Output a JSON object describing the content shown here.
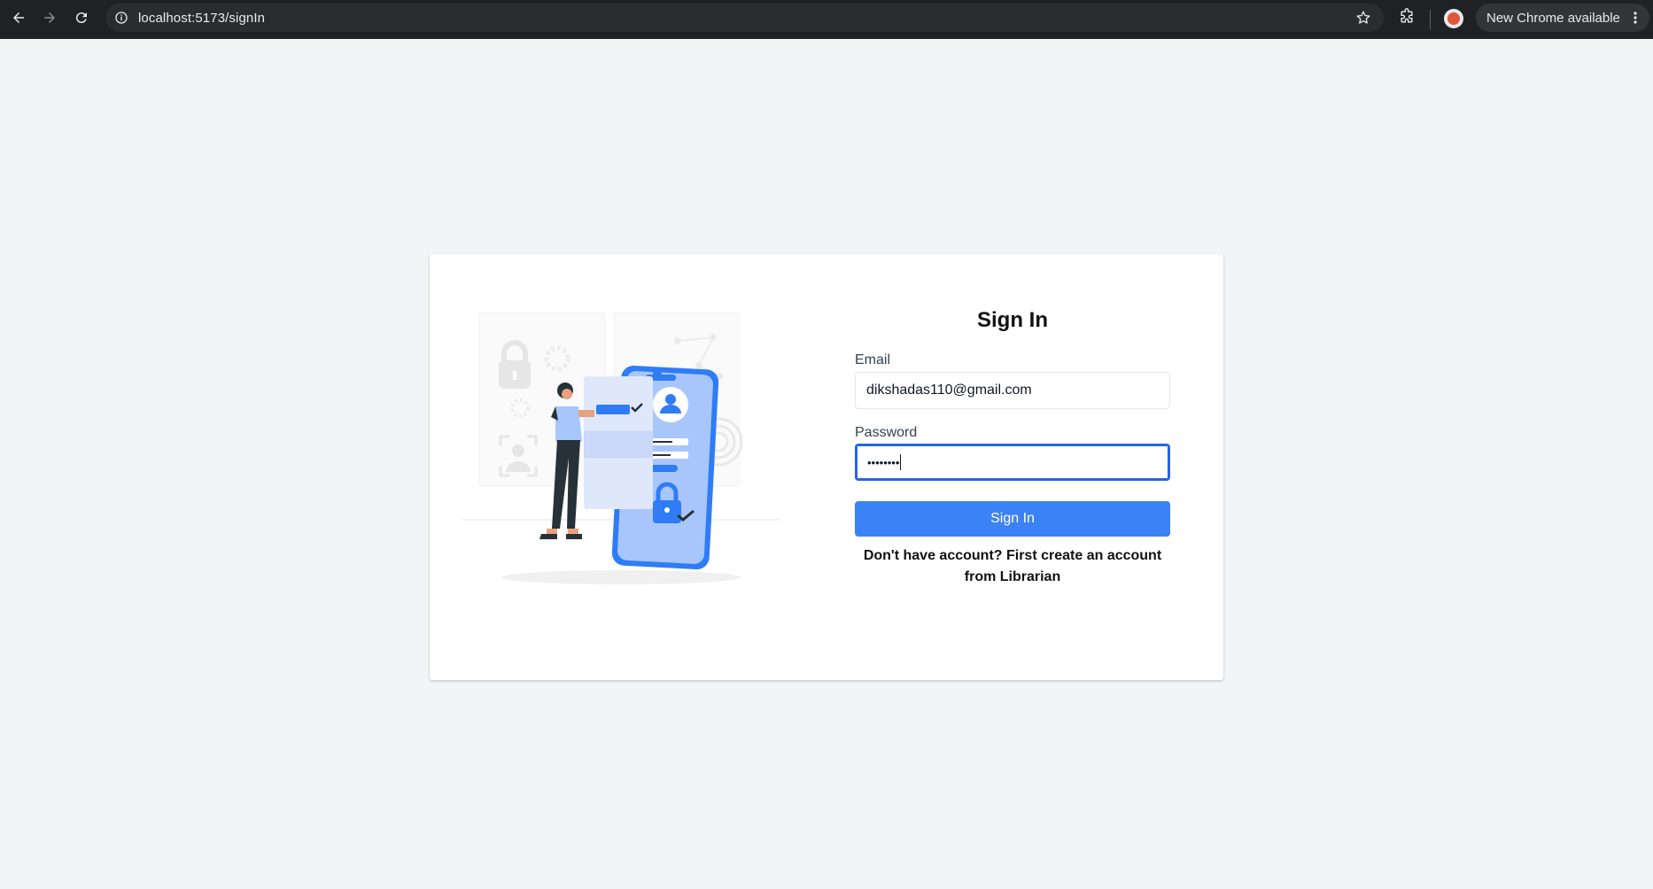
{
  "browser": {
    "url": "localhost:5173/signIn",
    "update_label": "New Chrome available",
    "icons": [
      "back-arrow-icon",
      "forward-arrow-icon",
      "reload-icon",
      "info-icon",
      "bookmark-star-icon",
      "extensions-icon",
      "profile-avatar-icon",
      "more-vert-icon"
    ]
  },
  "signin": {
    "title": "Sign In",
    "email_label": "Email",
    "email_value": "dikshadas110@gmail.com",
    "password_label": "Password",
    "password_masked": "••••••••",
    "submit_label": "Sign In",
    "note": "Don't have account? First create an account from Librarian"
  },
  "colors": {
    "accent": "#3b82f6",
    "focus_ring": "#2563eb",
    "page_bg": "#f3f4f6"
  }
}
